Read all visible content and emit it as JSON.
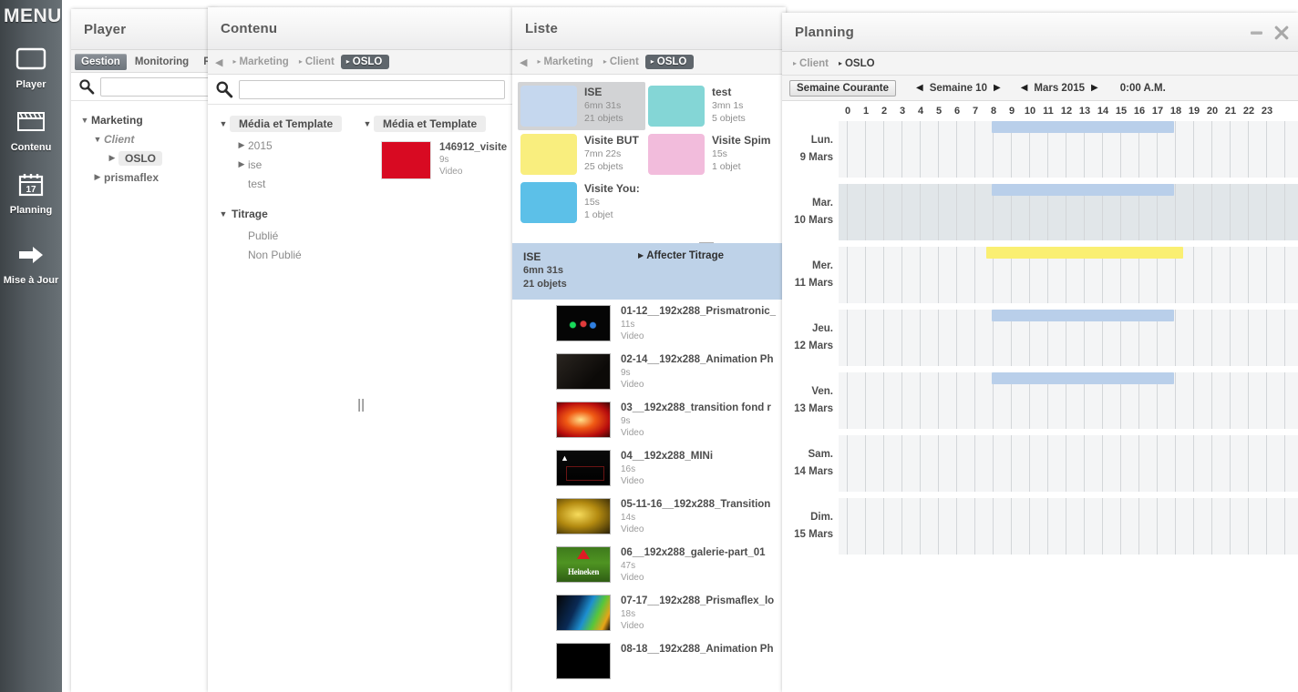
{
  "menu": {
    "title": "MENU",
    "items": [
      {
        "label": "Player",
        "icon": "monitor-icon"
      },
      {
        "label": "Contenu",
        "icon": "clapperboard-icon"
      },
      {
        "label": "Planning",
        "icon": "calendar-icon",
        "day": "17"
      },
      {
        "label": "Mise à Jour",
        "icon": "arrow-right-icon"
      }
    ]
  },
  "player": {
    "title": "Player",
    "tabs": [
      {
        "label": "Gestion",
        "selected": true
      },
      {
        "label": "Monitoring",
        "selected": false
      },
      {
        "label": "R",
        "selected": false
      }
    ],
    "search": {
      "value": "",
      "placeholder": ""
    },
    "tree": [
      {
        "label": "Marketing",
        "caret": "down",
        "indent": 0,
        "style": "root"
      },
      {
        "label": "Client",
        "caret": "down",
        "indent": 1,
        "style": "italic"
      },
      {
        "label": "OSLO",
        "caret": "right",
        "indent": 2,
        "style": "chip"
      },
      {
        "label": "prismaflex",
        "caret": "right",
        "indent": 1,
        "style": "plain"
      }
    ]
  },
  "contenu": {
    "title": "Contenu",
    "breadcrumb": [
      {
        "label": "Marketing",
        "selected": false
      },
      {
        "label": "Client",
        "selected": false
      },
      {
        "label": "OSLO",
        "selected": true
      }
    ],
    "search": {
      "value": "",
      "placeholder": ""
    },
    "left_tree": {
      "sections": [
        {
          "label": "Média et Template",
          "items": [
            {
              "label": "2015",
              "caret": "right"
            },
            {
              "label": "ise",
              "caret": "right"
            },
            {
              "label": "test",
              "caret": "none"
            }
          ]
        },
        {
          "label": "Titrage",
          "items": [
            {
              "label": "Publié",
              "caret": "none"
            },
            {
              "label": "Non Publié",
              "caret": "none"
            }
          ]
        }
      ]
    },
    "right_panel": {
      "section_label": "Média et Template",
      "items": [
        {
          "name": "146912_visite",
          "duration": "9s",
          "type": "Video",
          "color": "#d80a22"
        }
      ]
    }
  },
  "liste": {
    "title": "Liste",
    "breadcrumb": [
      {
        "label": "Marketing",
        "selected": false
      },
      {
        "label": "Client",
        "selected": false
      },
      {
        "label": "OSLO",
        "selected": true
      }
    ],
    "playlists": [
      {
        "name": "ISE",
        "duration": "6mn 31s",
        "objects": "21 objets",
        "color": "#c5d7ee",
        "selected": true
      },
      {
        "name": "test",
        "duration": "3mn 1s",
        "objects": "5 objets",
        "color": "#84d6d6",
        "selected": false
      },
      {
        "name": "Visite BUT",
        "duration": "7mn 22s",
        "objects": "25 objets",
        "color": "#f9ee7e",
        "selected": false
      },
      {
        "name": "Visite Spim",
        "duration": "15s",
        "objects": "1 objet",
        "color": "#f2bcdc",
        "selected": false
      },
      {
        "name": "Visite You:",
        "duration": "15s",
        "objects": "1 objet",
        "color": "#5cc0e8",
        "selected": false
      }
    ],
    "selected_bar": {
      "name": "ISE",
      "duration": "6mn 31s",
      "objects": "21 objets",
      "action": "Affecter Titrage"
    },
    "media": [
      {
        "name": "01-12__192x288_Prismatronic_",
        "duration": "11s",
        "type": "Video",
        "thumb": "dark-lights"
      },
      {
        "name": "02-14__192x288_Animation Ph",
        "duration": "9s",
        "type": "Video",
        "thumb": "dark-frame"
      },
      {
        "name": "03__192x288_transition fond r",
        "duration": "9s",
        "type": "Video",
        "thumb": "red-burst"
      },
      {
        "name": "04__192x288_MINi",
        "duration": "16s",
        "type": "Video",
        "thumb": "black-arrow"
      },
      {
        "name": "05-11-16__192x288_Transition",
        "duration": "14s",
        "type": "Video",
        "thumb": "gold-streaks"
      },
      {
        "name": "06__192x288_galerie-part_01",
        "duration": "47s",
        "type": "Video",
        "thumb": "heineken"
      },
      {
        "name": "07-17__192x288_Prismaflex_lo",
        "duration": "18s",
        "type": "Video",
        "thumb": "rainbow-dark"
      },
      {
        "name": "08-18__192x288_Animation Ph",
        "duration": "",
        "type": "",
        "thumb": "black"
      }
    ]
  },
  "planning": {
    "title": "Planning",
    "breadcrumb": [
      {
        "label": "Client",
        "selected": false
      },
      {
        "label": "OSLO",
        "selected": false
      }
    ],
    "toolbar": {
      "current_week_label": "Semaine Courante",
      "week_label": "Semaine 10",
      "month_label": "Mars 2015",
      "time_label": "0:00 A.M."
    },
    "hours": [
      "0",
      "1",
      "2",
      "3",
      "4",
      "5",
      "6",
      "7",
      "8",
      "9",
      "10",
      "11",
      "12",
      "13",
      "14",
      "15",
      "16",
      "17",
      "18",
      "19",
      "20",
      "21",
      "22",
      "23"
    ],
    "days": [
      {
        "weekday": "Lun.",
        "date": "9 Mars",
        "highlight": false,
        "events": [
          {
            "start": 8.0,
            "end": 17.5,
            "color": "#b9cfea"
          }
        ]
      },
      {
        "weekday": "Mar.",
        "date": "10 Mars",
        "highlight": true,
        "events": [
          {
            "start": 8.0,
            "end": 17.5,
            "color": "#b9cfea"
          }
        ]
      },
      {
        "weekday": "Mer.",
        "date": "11 Mars",
        "highlight": false,
        "events": [
          {
            "start": 7.7,
            "end": 18.0,
            "color": "#faef72"
          }
        ]
      },
      {
        "weekday": "Jeu.",
        "date": "12 Mars",
        "highlight": false,
        "events": [
          {
            "start": 8.0,
            "end": 17.5,
            "color": "#b9cfea"
          }
        ]
      },
      {
        "weekday": "Ven.",
        "date": "13 Mars",
        "highlight": false,
        "events": [
          {
            "start": 8.0,
            "end": 17.5,
            "color": "#b9cfea"
          }
        ]
      },
      {
        "weekday": "Sam.",
        "date": "14 Mars",
        "highlight": false,
        "events": []
      },
      {
        "weekday": "Dim.",
        "date": "15 Mars",
        "highlight": false,
        "events": []
      }
    ],
    "window_controls": [
      {
        "name": "minimize-icon",
        "glyph": "–"
      },
      {
        "name": "close-icon",
        "glyph": "✖"
      }
    ]
  }
}
